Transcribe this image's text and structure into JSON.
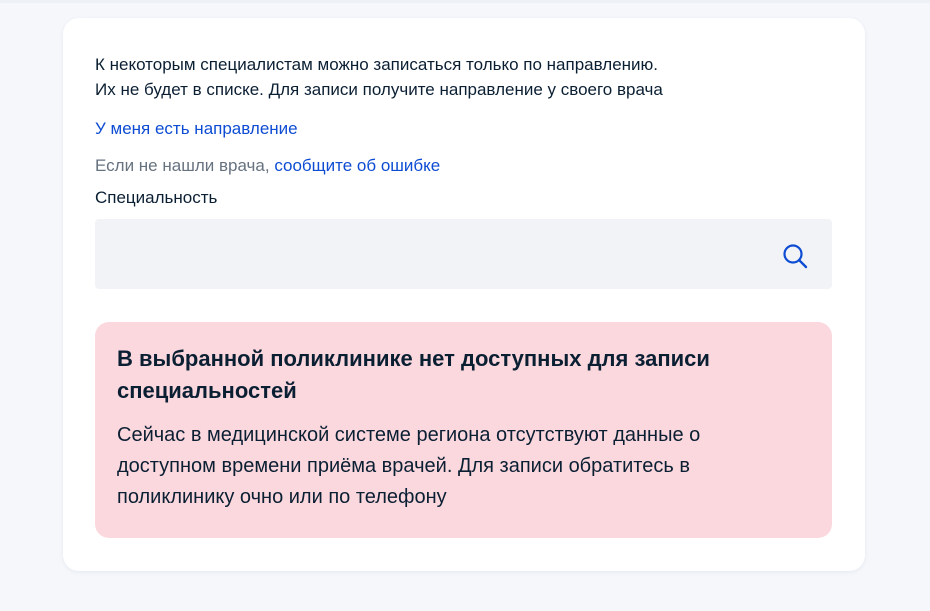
{
  "info": {
    "line1": "К некоторым специалистам можно записаться только по направлению.",
    "line2": "Их не будет в списке. Для записи получите направление у своего врача"
  },
  "referral_link": "У меня есть направление",
  "error_note": {
    "prefix": "Если не нашли врача,",
    "link": "сообщите об ошибке"
  },
  "specialty": {
    "label": "Специальность",
    "value": "",
    "search_icon": "search-icon"
  },
  "alert": {
    "title_line1": "В выбранной поликлинике нет доступных для записи",
    "title_line2": "специальностей",
    "text_line1": "Сейчас в медицинской системе региона отсутствуют данные о",
    "text_line2": "доступном времени приёма врачей. Для записи обратитесь в",
    "text_line3": "поликлинику очно или по телефону"
  },
  "colors": {
    "page_background": "#f5f7fb",
    "card_background": "#ffffff",
    "link": "#0d4cd3",
    "text": "#0b1f33",
    "muted_text": "#66727f",
    "input_background": "#f1f3f7",
    "alert_background": "#fbd8de"
  }
}
